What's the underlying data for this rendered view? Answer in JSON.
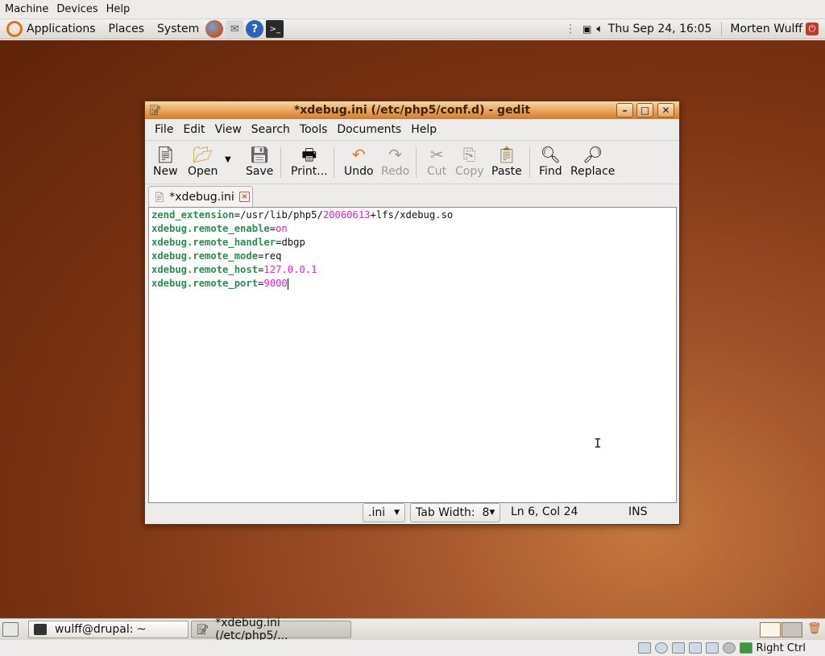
{
  "host_menu": {
    "items": [
      "Machine",
      "Devices",
      "Help"
    ]
  },
  "top_panel": {
    "menus": [
      "Applications",
      "Places",
      "System"
    ],
    "clock": "Thu Sep 24, 16:05",
    "user": "Morten Wulff"
  },
  "window": {
    "title": "*xdebug.ini (/etc/php5/conf.d) - gedit",
    "menu": [
      "File",
      "Edit",
      "View",
      "Search",
      "Tools",
      "Documents",
      "Help"
    ],
    "toolbar": {
      "new": "New",
      "open": "Open",
      "save": "Save",
      "print": "Print...",
      "undo": "Undo",
      "redo": "Redo",
      "cut": "Cut",
      "copy": "Copy",
      "paste": "Paste",
      "find": "Find",
      "replace": "Replace"
    },
    "tab": {
      "label": "*xdebug.ini"
    },
    "editor": {
      "lines": [
        {
          "key": "zend_extension",
          "sep": "=",
          "a": "/usr/lib/php5/",
          "b": "20060613",
          "c": "+lfs/xdebug.so"
        },
        {
          "key": "xdebug.remote_enable",
          "sep": "=",
          "a": "",
          "b": "on",
          "c": ""
        },
        {
          "key": "xdebug.remote_handler",
          "sep": "=",
          "a": "dbgp",
          "b": "",
          "c": ""
        },
        {
          "key": "xdebug.remote_mode",
          "sep": "=",
          "a": "req",
          "b": "",
          "c": ""
        },
        {
          "key": "xdebug.remote_host",
          "sep": "=",
          "a": "",
          "b": "127.0.0.1",
          "c": ""
        },
        {
          "key": "xdebug.remote_port",
          "sep": "=",
          "a": "",
          "b": "9000",
          "c": ""
        }
      ]
    },
    "statusbar": {
      "language": ".ini",
      "tab_width": "Tab Width:  8",
      "position": "Ln 6, Col 24",
      "mode": "INS"
    }
  },
  "taskbar": {
    "items": [
      "wulff@drupal: ~",
      "*xdebug.ini (/etc/php5/..."
    ]
  },
  "vbox_status": {
    "host_key": "Right Ctrl"
  },
  "colors": {
    "key": "#2e8b57",
    "value": "#e01ec8",
    "titlebar": "#e8a15a"
  }
}
